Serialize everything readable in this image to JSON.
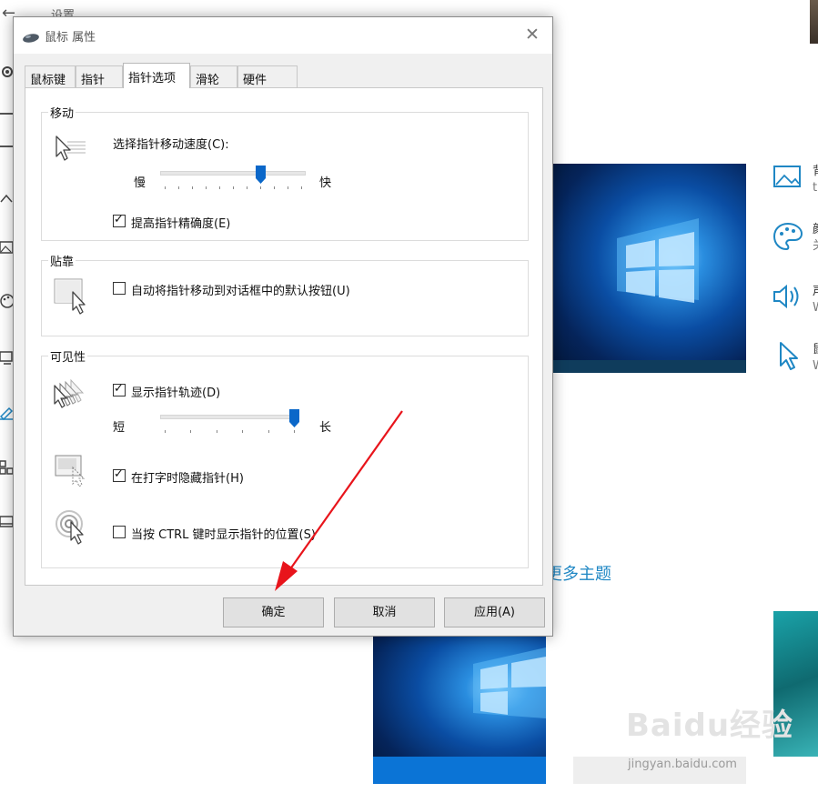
{
  "background": {
    "back_glyph": "←",
    "title": "设置",
    "more_themes": "更多主题",
    "side_items": [
      {
        "icon": "picture-icon",
        "title": "背",
        "sub": "t"
      },
      {
        "icon": "palette-icon",
        "title": "颜",
        "sub": "关"
      },
      {
        "icon": "speaker-icon",
        "title": "声",
        "sub": "W"
      },
      {
        "icon": "cursor-icon",
        "title": "鼠",
        "sub": "W"
      }
    ],
    "watermark": "Baidu经验",
    "watermark_sub": "jingyan.baidu.com"
  },
  "dialog": {
    "title": "鼠标 属性",
    "close_glyph": "✕",
    "tabs": [
      {
        "label": "鼠标键",
        "active": false
      },
      {
        "label": "指针",
        "active": false
      },
      {
        "label": "指针选项",
        "active": true
      },
      {
        "label": "滑轮",
        "active": false
      },
      {
        "label": "硬件",
        "active": false
      }
    ],
    "motion": {
      "legend": "移动",
      "speed_label": "选择指针移动速度(C):",
      "slow": "慢",
      "fast": "快",
      "speed_fraction": 0.7,
      "precision_label": "提高指针精确度(E)",
      "precision_checked": true
    },
    "snap": {
      "legend": "贴靠",
      "snap_label": "自动将指针移动到对话框中的默认按钮(U)",
      "snap_checked": false
    },
    "visibility": {
      "legend": "可见性",
      "trails_label": "显示指针轨迹(D)",
      "trails_checked": true,
      "short": "短",
      "long": "长",
      "trails_fraction": 1.0,
      "hide_label": "在打字时隐藏指针(H)",
      "hide_checked": true,
      "ctrl_label": "当按 CTRL 键时显示指针的位置(S)",
      "ctrl_checked": false
    },
    "buttons": {
      "ok": "确定",
      "cancel": "取消",
      "apply": "应用(A)"
    }
  },
  "colors": {
    "accent": "#0a67c9",
    "link": "#1f87c4",
    "annotation_arrow": "#e8141b"
  }
}
